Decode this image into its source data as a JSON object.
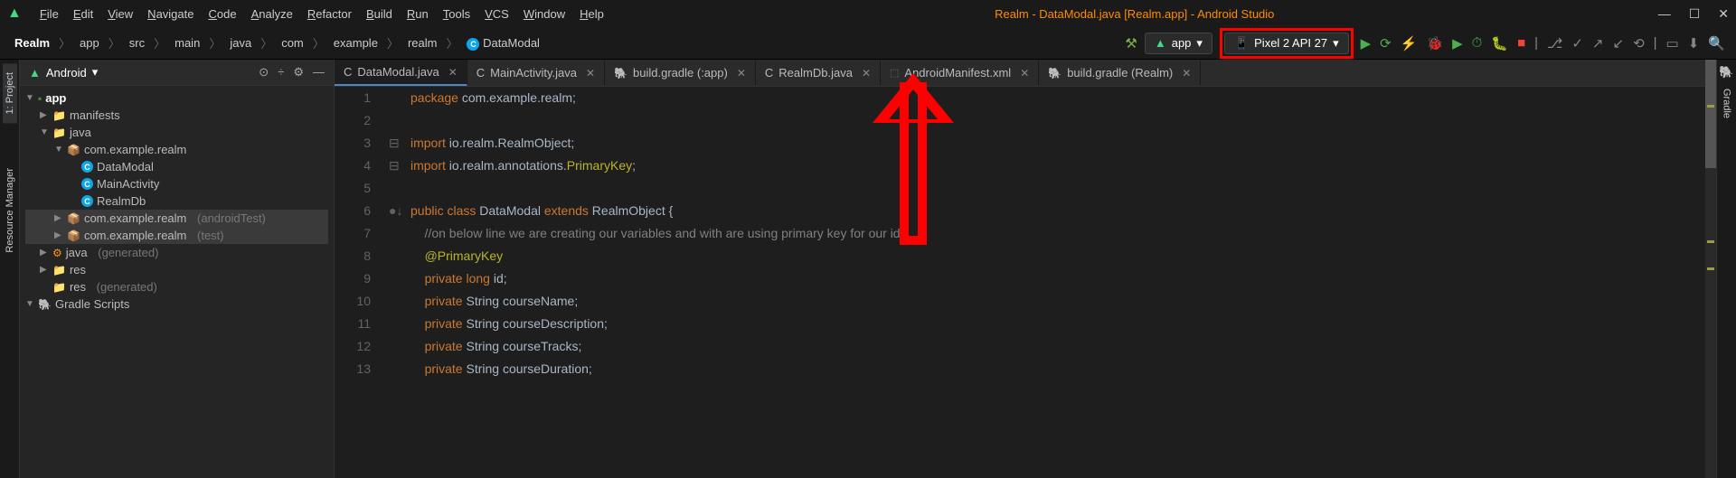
{
  "window": {
    "title": "Realm - DataModal.java [Realm.app] - Android Studio"
  },
  "menus": [
    "File",
    "Edit",
    "View",
    "Navigate",
    "Code",
    "Analyze",
    "Refactor",
    "Build",
    "Run",
    "Tools",
    "VCS",
    "Window",
    "Help"
  ],
  "breadcrumbs": [
    "Realm",
    "app",
    "src",
    "main",
    "java",
    "com",
    "example",
    "realm",
    "DataModal"
  ],
  "run_config": "app",
  "device": "Pixel 2 API 27",
  "sidebar": {
    "mode": "Android",
    "tree": {
      "app": "app",
      "manifests": "manifests",
      "java": "java",
      "pkg": "com.example.realm",
      "classes": [
        "DataModal",
        "MainActivity",
        "RealmDb"
      ],
      "pkg_test": "com.example.realm",
      "pkg_test_suffix": "(androidTest)",
      "pkg_utest": "com.example.realm",
      "pkg_utest_suffix": "(test)",
      "java_gen": "java",
      "java_gen_suffix": "(generated)",
      "res": "res",
      "res_gen": "res",
      "res_gen_suffix": "(generated)",
      "gradle_scripts": "Gradle Scripts"
    }
  },
  "tabs": [
    {
      "label": "DataModal.java",
      "icon": "c",
      "active": true
    },
    {
      "label": "MainActivity.java",
      "icon": "c"
    },
    {
      "label": "build.gradle (:app)",
      "icon": "gradle"
    },
    {
      "label": "RealmDb.java",
      "icon": "c"
    },
    {
      "label": "AndroidManifest.xml",
      "icon": "xml"
    },
    {
      "label": "build.gradle (Realm)",
      "icon": "gradle"
    }
  ],
  "left_tools": [
    "1: Project",
    "Resource Manager"
  ],
  "right_tools": [
    "Gradle"
  ],
  "code": {
    "lines": [
      {
        "n": 1,
        "seg": [
          {
            "t": "package ",
            "c": "kw"
          },
          {
            "t": "com.example.realm;",
            "c": ""
          }
        ]
      },
      {
        "n": 2,
        "seg": []
      },
      {
        "n": 3,
        "seg": [
          {
            "t": "import ",
            "c": "kw"
          },
          {
            "t": "io.realm.RealmObject;",
            "c": ""
          }
        ],
        "fold": "⊟"
      },
      {
        "n": 4,
        "seg": [
          {
            "t": "import ",
            "c": "kw"
          },
          {
            "t": "io.realm.annotations.",
            "c": ""
          },
          {
            "t": "PrimaryKey",
            "c": "ann"
          },
          {
            "t": ";",
            "c": ""
          }
        ],
        "fold": "⊟"
      },
      {
        "n": 5,
        "seg": []
      },
      {
        "n": 6,
        "seg": [
          {
            "t": "public class ",
            "c": "kw"
          },
          {
            "t": "DataModal ",
            "c": "cls"
          },
          {
            "t": "extends ",
            "c": "kw"
          },
          {
            "t": "RealmObject {",
            "c": ""
          }
        ],
        "mark": "●↓"
      },
      {
        "n": 7,
        "seg": [
          {
            "t": "    //on below line we are creating our variables and with are using primary key for our id.",
            "c": "com"
          }
        ]
      },
      {
        "n": 8,
        "seg": [
          {
            "t": "    ",
            "c": ""
          },
          {
            "t": "@PrimaryKey",
            "c": "ann"
          }
        ]
      },
      {
        "n": 9,
        "seg": [
          {
            "t": "    ",
            "c": ""
          },
          {
            "t": "private long ",
            "c": "kw"
          },
          {
            "t": "id;",
            "c": ""
          }
        ]
      },
      {
        "n": 10,
        "seg": [
          {
            "t": "    ",
            "c": ""
          },
          {
            "t": "private ",
            "c": "kw"
          },
          {
            "t": "String ",
            "c": "type"
          },
          {
            "t": "courseName;",
            "c": ""
          }
        ]
      },
      {
        "n": 11,
        "seg": [
          {
            "t": "    ",
            "c": ""
          },
          {
            "t": "private ",
            "c": "kw"
          },
          {
            "t": "String ",
            "c": "type"
          },
          {
            "t": "courseDescription;",
            "c": ""
          }
        ]
      },
      {
        "n": 12,
        "seg": [
          {
            "t": "    ",
            "c": ""
          },
          {
            "t": "private ",
            "c": "kw"
          },
          {
            "t": "String ",
            "c": "type"
          },
          {
            "t": "courseTracks;",
            "c": ""
          }
        ]
      },
      {
        "n": 13,
        "seg": [
          {
            "t": "    ",
            "c": ""
          },
          {
            "t": "private ",
            "c": "kw"
          },
          {
            "t": "String ",
            "c": "type"
          },
          {
            "t": "courseDuration;",
            "c": ""
          }
        ]
      }
    ]
  }
}
